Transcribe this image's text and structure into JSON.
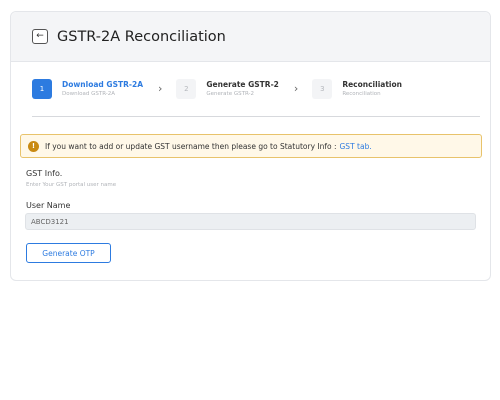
{
  "header": {
    "back_icon": "arrow-left-icon",
    "back_glyph": "←",
    "title": "GSTR-2A Reconciliation"
  },
  "steps": [
    {
      "number": "1",
      "title": "Download GSTR-2A",
      "subtitle": "Download GSTR-2A",
      "active": true
    },
    {
      "number": "2",
      "title": "Generate GSTR-2",
      "subtitle": "Generate GSTR-2",
      "active": false
    },
    {
      "number": "3",
      "title": "Reconciliation",
      "subtitle": "Reconciliation",
      "active": false
    }
  ],
  "step_separator_glyph": "›",
  "alert": {
    "icon": "info-icon",
    "icon_glyph": "!",
    "text": "If you want to add or update GST username then please go to Statutory Info :",
    "link": "GST tab."
  },
  "gst_info": {
    "title": "GST Info.",
    "subtitle": "Enter Your GST portal user name"
  },
  "username": {
    "label": "User Name",
    "value": "ABCD3121"
  },
  "actions": {
    "generate_otp_label": "Generate OTP"
  },
  "colors": {
    "primary": "#2d7be0",
    "alert_bg": "#fff8e8",
    "alert_border": "#e8c36b",
    "alert_icon": "#c98a12"
  }
}
